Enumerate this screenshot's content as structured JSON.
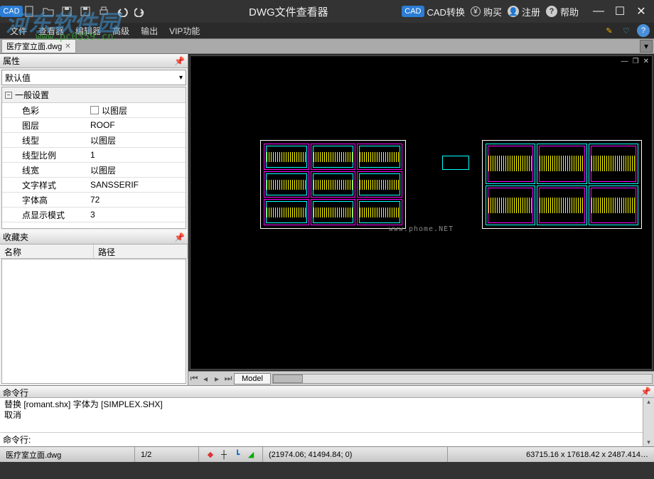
{
  "watermark": {
    "logo": "河东软件园",
    "url": "www.pc0359.cn",
    "canvas": "www.phome.NET"
  },
  "title": "DWG文件查看器",
  "title_right": {
    "cad_badge": "CAD",
    "cad_convert": "CAD转换",
    "buy": "购买",
    "register": "注册",
    "help": "帮助"
  },
  "menu": {
    "items": [
      "文件",
      "查看器",
      "编辑器",
      "高级",
      "输出",
      "VIP功能"
    ]
  },
  "tabs": {
    "active": "医疗室立面.dwg"
  },
  "properties": {
    "panel_title": "属性",
    "default_combo": "默认值",
    "section": "一般设置",
    "rows": [
      {
        "k": "色彩",
        "v": "以图层",
        "checkbox": true
      },
      {
        "k": "图层",
        "v": "ROOF"
      },
      {
        "k": "线型",
        "v": "以图层"
      },
      {
        "k": "线型比例",
        "v": "1"
      },
      {
        "k": "线宽",
        "v": "以图层"
      },
      {
        "k": "文字样式",
        "v": "SANSSERIF"
      },
      {
        "k": "字体高",
        "v": "72"
      },
      {
        "k": "点显示模式",
        "v": "3"
      }
    ]
  },
  "favorites": {
    "panel_title": "收藏夹",
    "col_name": "名称",
    "col_path": "路径"
  },
  "model_tab": "Model",
  "command": {
    "panel_title": "命令行",
    "log": [
      "替换 [romant.shx] 字体为 [SIMPLEX.SHX]",
      "取消"
    ],
    "prompt": "命令行:"
  },
  "status": {
    "file": "医疗室立面.dwg",
    "page": "1/2",
    "coords": "(21974.06; 41494.84; 0)",
    "dims": "63715.16 x 17618.42 x 2487.414…"
  }
}
